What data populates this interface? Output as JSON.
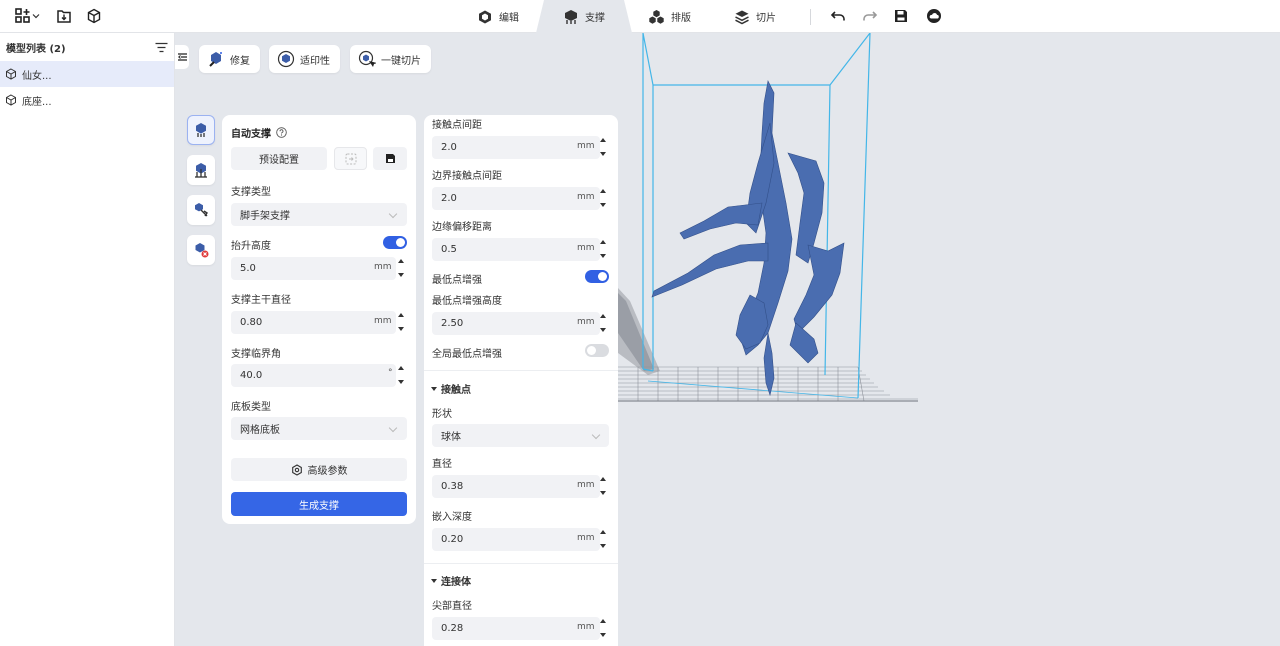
{
  "topbar": {
    "tabs": [
      {
        "label": "编辑",
        "icon": "cube-edit-icon"
      },
      {
        "label": "支撑",
        "icon": "support-icon"
      },
      {
        "label": "排版",
        "icon": "layout-icon"
      },
      {
        "label": "切片",
        "icon": "layers-icon"
      }
    ],
    "active_tab": "支撑"
  },
  "model_list": {
    "title": "模型列表 (2)",
    "items": [
      {
        "name": "仙女...",
        "selected": true
      },
      {
        "name": "底座...",
        "selected": false
      }
    ]
  },
  "toolbar": {
    "repair_label": "修复",
    "printability_label": "适印性",
    "one_click_slice_label": "一键切片"
  },
  "auto_support": {
    "title": "自动支撑",
    "preset_label": "预设配置",
    "support_type_label": "支撑类型",
    "support_type_value": "脚手架支撑",
    "lift_height_label": "抬升高度",
    "lift_height_enabled": true,
    "lift_height_value": "5.0",
    "lift_height_unit": "mm",
    "trunk_diameter_label": "支撑主干直径",
    "trunk_diameter_value": "0.80",
    "trunk_diameter_unit": "mm",
    "critical_angle_label": "支撑临界角",
    "critical_angle_value": "40.0",
    "critical_angle_unit": "°",
    "base_type_label": "底板类型",
    "base_type_value": "网格底板",
    "advanced_label": "高级参数",
    "generate_label": "生成支撑"
  },
  "advanced": {
    "contact_spacing_label": "接触点间距",
    "contact_spacing_value": "2.0",
    "edge_contact_spacing_label": "边界接触点间距",
    "edge_contact_spacing_value": "2.0",
    "edge_offset_label": "边缘偏移距离",
    "edge_offset_value": "0.5",
    "lowest_point_label": "最低点增强",
    "lowest_point_enabled": true,
    "lowest_point_height_label": "最低点增强高度",
    "lowest_point_height_value": "2.50",
    "global_lowest_label": "全局最低点增强",
    "global_lowest_enabled": false,
    "unit": "mm",
    "contact_section": "接触点",
    "shape_label": "形状",
    "shape_value": "球体",
    "diameter_label": "直径",
    "diameter_value": "0.38",
    "embed_depth_label": "嵌入深度",
    "embed_depth_value": "0.20",
    "connector_section": "连接体",
    "tip_diameter_label": "尖部直径",
    "tip_diameter_value": "0.28"
  },
  "colors": {
    "accent": "#3160e3",
    "model": "#4a6db0",
    "build_volume": "#43b6e8",
    "background": "#e4e7ec"
  }
}
